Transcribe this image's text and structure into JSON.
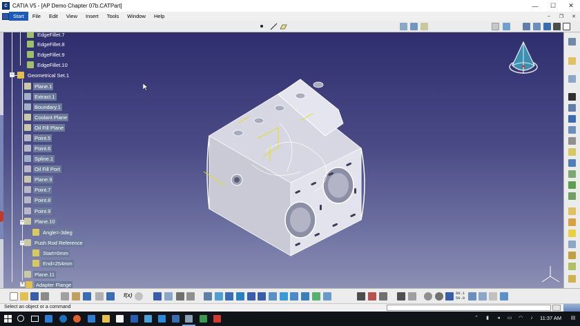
{
  "window": {
    "title": "CATIA V5 - [AP Demo Chapter 07b.CATPart]",
    "app_icon_text": "C",
    "controls": [
      "—",
      "☐",
      "✕"
    ]
  },
  "menu": {
    "items": [
      "Start",
      "File",
      "Edit",
      "View",
      "Insert",
      "Tools",
      "Window",
      "Help"
    ],
    "mdi_controls": [
      "–",
      "❐",
      "✕"
    ]
  },
  "spec_tree": {
    "nodes": [
      {
        "label": "EdgeFillet.7",
        "kind": "fillet"
      },
      {
        "label": "EdgeFillet.8",
        "kind": "fillet"
      },
      {
        "label": "EdgeFillet.9",
        "kind": "fillet"
      },
      {
        "label": "EdgeFillet.10",
        "kind": "fillet"
      },
      {
        "label": "Geometrical Set.1",
        "kind": "set"
      },
      {
        "label": "Plane.1",
        "kind": "plane"
      },
      {
        "label": "Extract.1",
        "kind": "extract"
      },
      {
        "label": "Boundary.1",
        "kind": "boundary"
      },
      {
        "label": "Coolant Plane",
        "kind": "plane"
      },
      {
        "label": "Oil Fill Plane",
        "kind": "plane"
      },
      {
        "label": "Point.5",
        "kind": "point"
      },
      {
        "label": "Point.6",
        "kind": "point"
      },
      {
        "label": "Spline.1",
        "kind": "spline"
      },
      {
        "label": "Oil Fill Port",
        "kind": "point"
      },
      {
        "label": "Plane.9",
        "kind": "plane"
      },
      {
        "label": "Point.7",
        "kind": "point"
      },
      {
        "label": "Point.8",
        "kind": "point"
      },
      {
        "label": "Point.9",
        "kind": "point"
      },
      {
        "label": "Plane.10",
        "kind": "plane"
      },
      {
        "label": "Angle=-3deg",
        "kind": "param"
      },
      {
        "label": "Push Rod Reference",
        "kind": "plane"
      },
      {
        "label": "Start=0mm",
        "kind": "param"
      },
      {
        "label": "End=254mm",
        "kind": "param"
      },
      {
        "label": "Plane.11",
        "kind": "plane"
      },
      {
        "label": "Adapter Flange",
        "kind": "set"
      }
    ]
  },
  "toolbar": {
    "fx_label": "f(x)",
    "numeric_lines": [
      "60.1",
      "50.0"
    ]
  },
  "status": {
    "message": "Select an object or a command",
    "command_input": ""
  },
  "taskbar": {
    "time": "11:37 AM"
  },
  "colors": {
    "viewport_top": "#2f2e6e",
    "viewport_bottom": "#8c90b5",
    "tree_highlight": "#6c7a99",
    "menu_active": "#1e5bb8",
    "part_body": "#dcdde6",
    "geometry_yellow": "#e6e000"
  }
}
